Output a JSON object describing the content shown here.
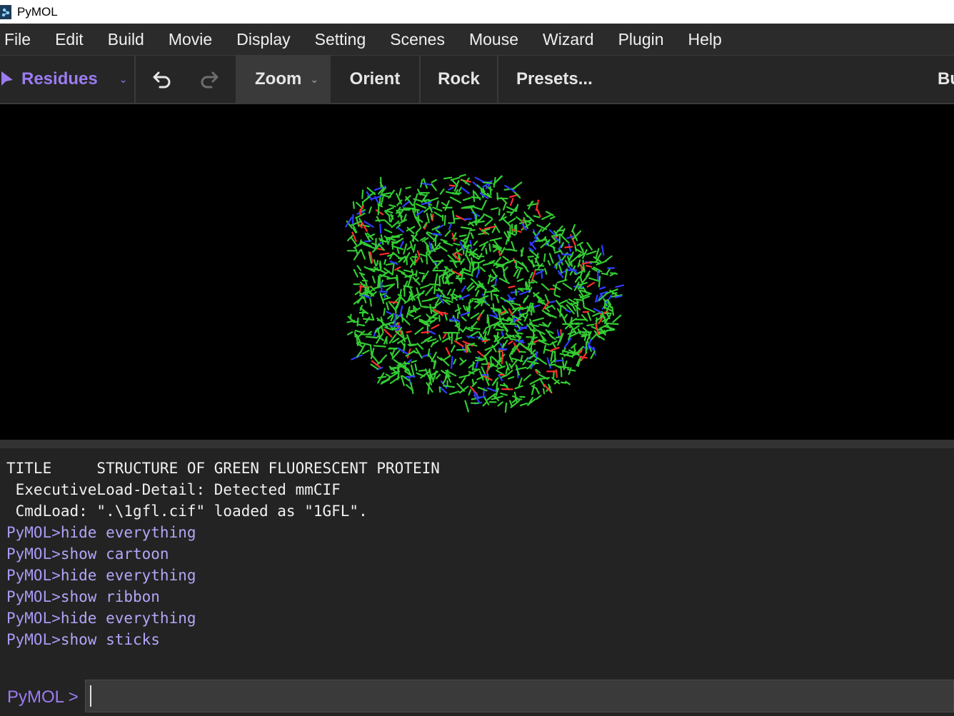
{
  "window": {
    "title": "PyMOL"
  },
  "menu": {
    "items": [
      "File",
      "Edit",
      "Build",
      "Movie",
      "Display",
      "Setting",
      "Scenes",
      "Mouse",
      "Wizard",
      "Plugin",
      "Help"
    ]
  },
  "toolbar": {
    "selection_mode": "Residues",
    "zoom_label": "Zoom",
    "orient_label": "Orient",
    "rock_label": "Rock",
    "presets_label": "Presets...",
    "builder_label": "Bu"
  },
  "viewport": {
    "background": "#000000",
    "carbon_color": "#33cc33",
    "nitrogen_color": "#2f3dff",
    "oxygen_color": "#ff2d2d",
    "representation": "sticks"
  },
  "console": {
    "lines": [
      {
        "kind": "info",
        "prefix": "",
        "text": "TITLE     STRUCTURE OF GREEN FLUORESCENT PROTEIN"
      },
      {
        "kind": "info",
        "prefix": "",
        "text": " ExecutiveLoad-Detail: Detected mmCIF"
      },
      {
        "kind": "info",
        "prefix": "",
        "text": " CmdLoad: \".\\1gfl.cif\" loaded as \"1GFL\"."
      },
      {
        "kind": "cmd",
        "prefix": "PyMOL>",
        "text": "hide everything"
      },
      {
        "kind": "cmd",
        "prefix": "PyMOL>",
        "text": "show cartoon"
      },
      {
        "kind": "cmd",
        "prefix": "PyMOL>",
        "text": "hide everything"
      },
      {
        "kind": "cmd",
        "prefix": "PyMOL>",
        "text": "show ribbon"
      },
      {
        "kind": "cmd",
        "prefix": "PyMOL>",
        "text": "hide everything"
      },
      {
        "kind": "cmd",
        "prefix": "PyMOL>",
        "text": "show sticks"
      }
    ]
  },
  "command": {
    "prompt": "PyMOL >",
    "value": ""
  },
  "colors": {
    "accent": "#9c7cf2"
  }
}
